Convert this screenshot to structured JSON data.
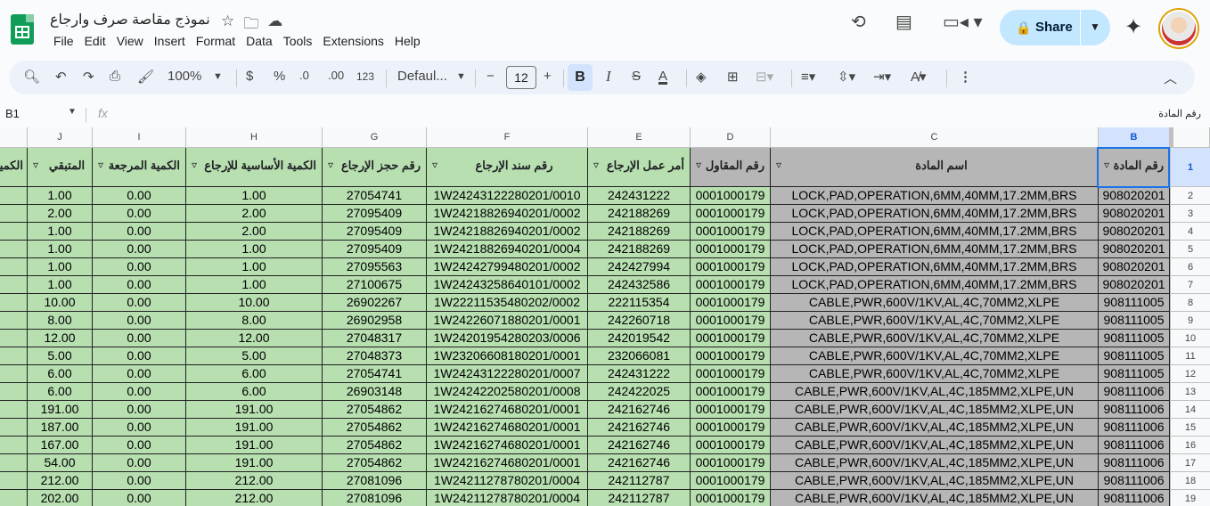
{
  "header": {
    "doc_title": "نموذج مقاصة صرف وارجاع",
    "menu": [
      "File",
      "Edit",
      "View",
      "Insert",
      "Format",
      "Data",
      "Tools",
      "Extensions",
      "Help"
    ],
    "share_label": "Share"
  },
  "toolbar": {
    "zoom": "100%",
    "currency": "$",
    "percent": "%",
    "dec_dec": ".0",
    "dec_inc": ".00",
    "number_format": "123",
    "font": "Defaul...",
    "font_size": "12",
    "bold": "B",
    "italic": "I",
    "strike": "S",
    "text_color": "A"
  },
  "formula_bar": {
    "cell_ref": "B1",
    "fx": "fx",
    "value": "رقم المادة"
  },
  "columns": [
    "B",
    "C",
    "D",
    "E",
    "F",
    "G",
    "H",
    "I",
    "J"
  ],
  "headers": {
    "B": "رقم المادة",
    "C": "اسم المادة",
    "D": "رقم المقاول",
    "E": "أمر عمل الإرجاع",
    "F": "رقم سند الإرجاع",
    "G": "رقم حجز الإرجاع",
    "H": "الكمية الأساسية للإرجاع",
    "I": "الكمية المرجعة",
    "J": "المتبقي",
    "K": "الكمية"
  },
  "rows": [
    {
      "n": "2",
      "B": "908020201",
      "C": "LOCK,PAD,OPERATION,6MM,40MM,17.2MM,BRS",
      "D": "0001000179",
      "E": "242431222",
      "F": "1W24243122280201/0010",
      "G": "27054741",
      "H": "1.00",
      "I": "0.00",
      "J": "1.00"
    },
    {
      "n": "3",
      "B": "908020201",
      "C": "LOCK,PAD,OPERATION,6MM,40MM,17.2MM,BRS",
      "D": "0001000179",
      "E": "242188269",
      "F": "1W24218826940201/0002",
      "G": "27095409",
      "H": "2.00",
      "I": "0.00",
      "J": "2.00"
    },
    {
      "n": "4",
      "B": "908020201",
      "C": "LOCK,PAD,OPERATION,6MM,40MM,17.2MM,BRS",
      "D": "0001000179",
      "E": "242188269",
      "F": "1W24218826940201/0002",
      "G": "27095409",
      "H": "2.00",
      "I": "0.00",
      "J": "1.00"
    },
    {
      "n": "5",
      "B": "908020201",
      "C": "LOCK,PAD,OPERATION,6MM,40MM,17.2MM,BRS",
      "D": "0001000179",
      "E": "242188269",
      "F": "1W24218826940201/0004",
      "G": "27095409",
      "H": "1.00",
      "I": "0.00",
      "J": "1.00"
    },
    {
      "n": "6",
      "B": "908020201",
      "C": "LOCK,PAD,OPERATION,6MM,40MM,17.2MM,BRS",
      "D": "0001000179",
      "E": "242427994",
      "F": "1W24242799480201/0002",
      "G": "27095563",
      "H": "1.00",
      "I": "0.00",
      "J": "1.00"
    },
    {
      "n": "7",
      "B": "908020201",
      "C": "LOCK,PAD,OPERATION,6MM,40MM,17.2MM,BRS",
      "D": "0001000179",
      "E": "242432586",
      "F": "1W24243258640101/0002",
      "G": "27100675",
      "H": "1.00",
      "I": "0.00",
      "J": "1.00"
    },
    {
      "n": "8",
      "B": "908111005",
      "C": "CABLE,PWR,600V/1KV,AL,4C,70MM2,XLPE",
      "D": "0001000179",
      "E": "222115354",
      "F": "1W22211535480202/0002",
      "G": "26902267",
      "H": "10.00",
      "I": "0.00",
      "J": "10.00"
    },
    {
      "n": "9",
      "B": "908111005",
      "C": "CABLE,PWR,600V/1KV,AL,4C,70MM2,XLPE",
      "D": "0001000179",
      "E": "242260718",
      "F": "1W24226071880201/0001",
      "G": "26902958",
      "H": "8.00",
      "I": "0.00",
      "J": "8.00"
    },
    {
      "n": "10",
      "B": "908111005",
      "C": "CABLE,PWR,600V/1KV,AL,4C,70MM2,XLPE",
      "D": "0001000179",
      "E": "242019542",
      "F": "1W24201954280203/0006",
      "G": "27048317",
      "H": "12.00",
      "I": "0.00",
      "J": "12.00"
    },
    {
      "n": "11",
      "B": "908111005",
      "C": "CABLE,PWR,600V/1KV,AL,4C,70MM2,XLPE",
      "D": "0001000179",
      "E": "232066081",
      "F": "1W23206608180201/0001",
      "G": "27048373",
      "H": "5.00",
      "I": "0.00",
      "J": "5.00"
    },
    {
      "n": "12",
      "B": "908111005",
      "C": "CABLE,PWR,600V/1KV,AL,4C,70MM2,XLPE",
      "D": "0001000179",
      "E": "242431222",
      "F": "1W24243122280201/0007",
      "G": "27054741",
      "H": "6.00",
      "I": "0.00",
      "J": "6.00"
    },
    {
      "n": "13",
      "B": "908111006",
      "C": "CABLE,PWR,600V/1KV,AL,4C,185MM2,XLPE,UN",
      "D": "0001000179",
      "E": "242422025",
      "F": "1W24242202580201/0008",
      "G": "26903148",
      "H": "6.00",
      "I": "0.00",
      "J": "6.00"
    },
    {
      "n": "14",
      "B": "908111006",
      "C": "CABLE,PWR,600V/1KV,AL,4C,185MM2,XLPE,UN",
      "D": "0001000179",
      "E": "242162746",
      "F": "1W24216274680201/0001",
      "G": "27054862",
      "H": "191.00",
      "I": "0.00",
      "J": "191.00"
    },
    {
      "n": "15",
      "B": "908111006",
      "C": "CABLE,PWR,600V/1KV,AL,4C,185MM2,XLPE,UN",
      "D": "0001000179",
      "E": "242162746",
      "F": "1W24216274680201/0001",
      "G": "27054862",
      "H": "191.00",
      "I": "0.00",
      "J": "187.00"
    },
    {
      "n": "16",
      "B": "908111006",
      "C": "CABLE,PWR,600V/1KV,AL,4C,185MM2,XLPE,UN",
      "D": "0001000179",
      "E": "242162746",
      "F": "1W24216274680201/0001",
      "G": "27054862",
      "H": "191.00",
      "I": "0.00",
      "J": "167.00"
    },
    {
      "n": "17",
      "B": "908111006",
      "C": "CABLE,PWR,600V/1KV,AL,4C,185MM2,XLPE,UN",
      "D": "0001000179",
      "E": "242162746",
      "F": "1W24216274680201/0001",
      "G": "27054862",
      "H": "191.00",
      "I": "0.00",
      "J": "54.00"
    },
    {
      "n": "18",
      "B": "908111006",
      "C": "CABLE,PWR,600V/1KV,AL,4C,185MM2,XLPE,UN",
      "D": "0001000179",
      "E": "242112787",
      "F": "1W24211278780201/0004",
      "G": "27081096",
      "H": "212.00",
      "I": "0.00",
      "J": "212.00"
    },
    {
      "n": "19",
      "B": "908111006",
      "C": "CABLE,PWR,600V/1KV,AL,4C,185MM2,XLPE,UN",
      "D": "0001000179",
      "E": "242112787",
      "F": "1W24211278780201/0004",
      "G": "27081096",
      "H": "212.00",
      "I": "0.00",
      "J": "202.00"
    }
  ],
  "colors": {
    "green_fill": "#b7dfb0",
    "gray_fill": "#b6b6b6",
    "accent": "#1a73e8",
    "share_bg": "#c2e7ff"
  }
}
